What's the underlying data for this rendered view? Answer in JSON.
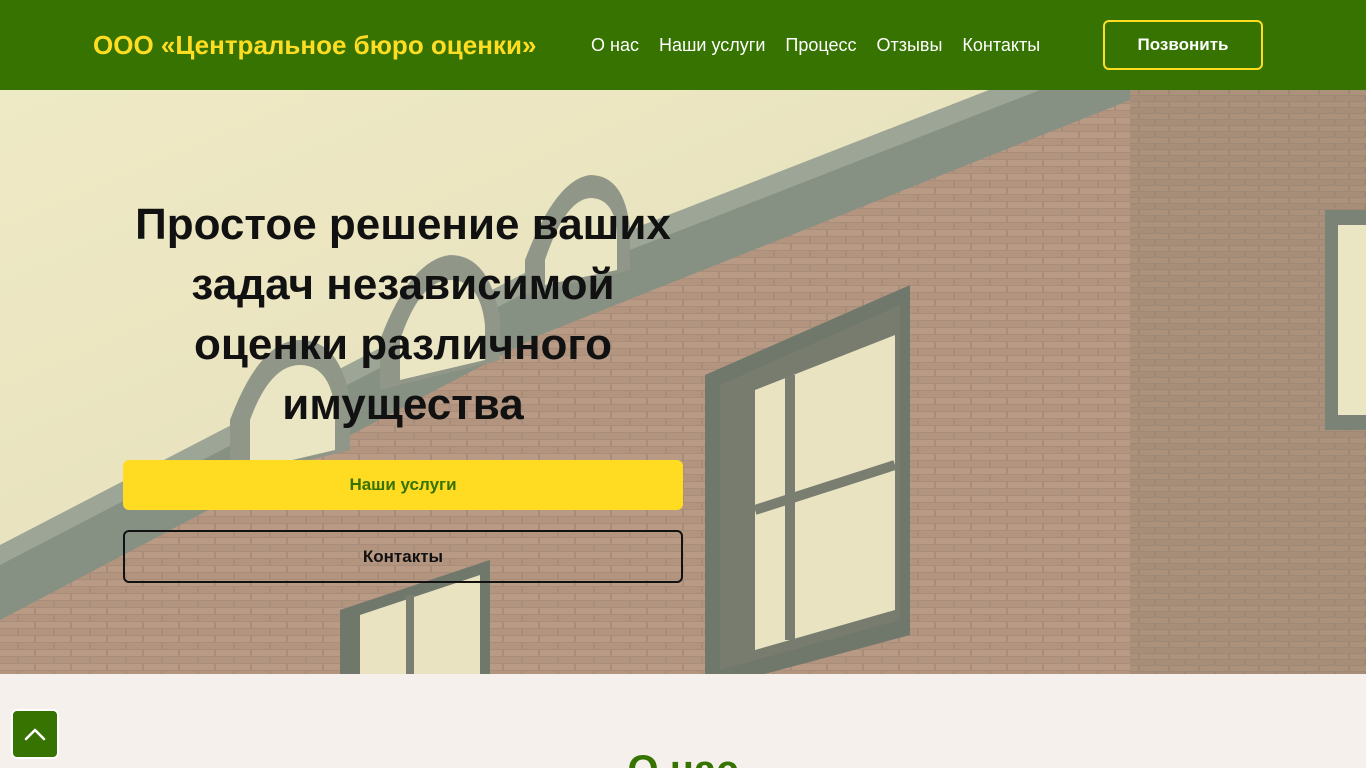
{
  "header": {
    "brand": "ООО «Центральное бюро оценки»",
    "nav": [
      "О нас",
      "Наши услуги",
      "Процесс",
      "Отзывы",
      "Контакты"
    ],
    "call_label": "Позвонить"
  },
  "hero": {
    "title": "Простое решение ваших задач независимой оценки различного имущества",
    "primary_label": "Наши услуги",
    "secondary_label": "Контакты"
  },
  "about": {
    "title": "О нас"
  },
  "icons": {
    "scroll_top": "chevron-up-icon"
  },
  "colors": {
    "brand_green": "#367300",
    "accent_yellow": "#ffdb22"
  }
}
